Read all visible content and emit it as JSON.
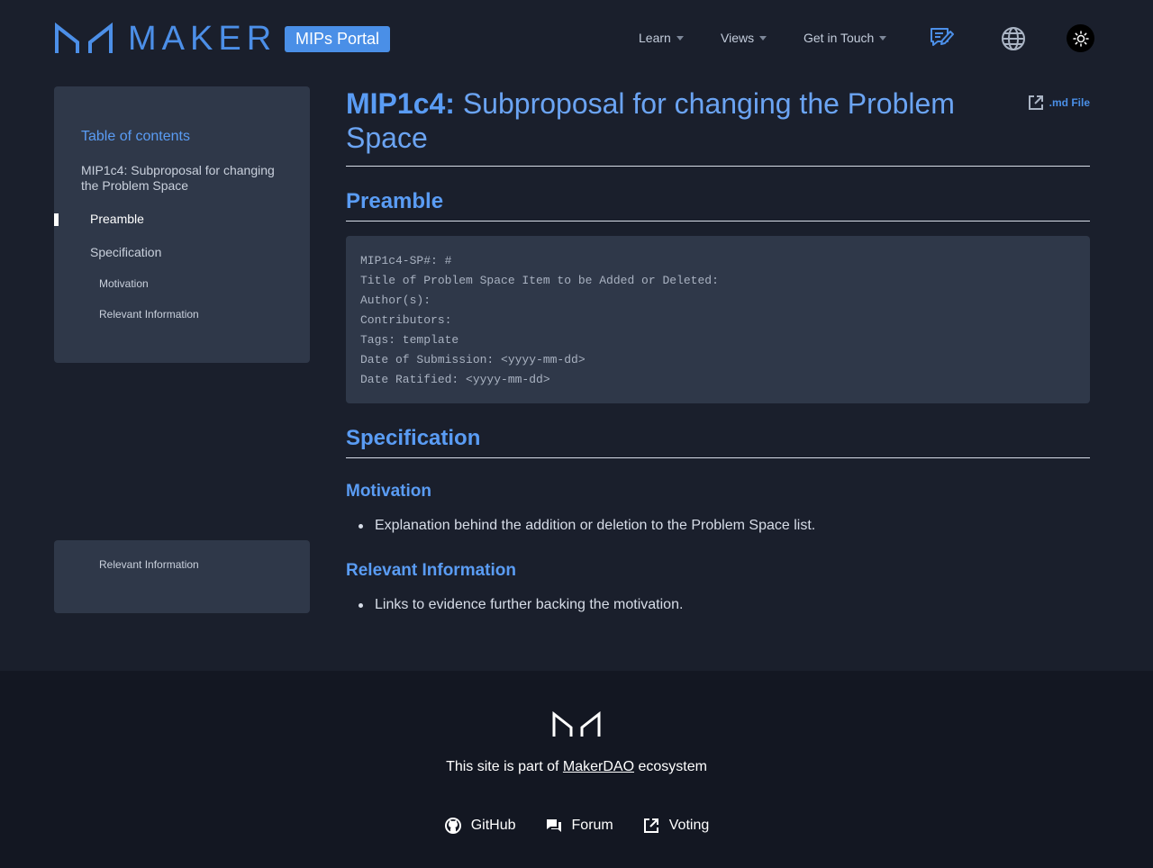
{
  "header": {
    "logo_word": "MAKER",
    "badge": "MIPs Portal",
    "nav": [
      {
        "label": "Learn"
      },
      {
        "label": "Views"
      },
      {
        "label": "Get in Touch"
      }
    ],
    "icons": [
      "forum-edit-icon",
      "globe-icon",
      "sun-icon"
    ]
  },
  "sidebar": {
    "title": "Table of contents",
    "doc_link": "MIP1c4: Subproposal for changing the Problem Space",
    "items": [
      {
        "label": "Preamble",
        "active": true
      },
      {
        "label": "Specification"
      },
      {
        "label": "Motivation"
      },
      {
        "label": "Relevant Information"
      }
    ],
    "sticky_item": "Relevant Information"
  },
  "main": {
    "title_id": "MIP1c4:",
    "title_rest": " Subproposal for changing the Problem Space",
    "md_link": ".md File",
    "preamble_heading": "Preamble",
    "code_lines": [
      "MIP1c4-SP#: #",
      "Title of Problem Space Item to be Added or Deleted:",
      "Author(s):",
      "Contributors:",
      "Tags: template",
      "Date of Submission: <yyyy-mm-dd>",
      "Date Ratified: <yyyy-mm-dd>"
    ],
    "spec_heading": "Specification",
    "motivation_heading": "Motivation",
    "motivation_bullet": "Explanation behind the addition or deletion to the Problem Space list.",
    "relevant_heading": "Relevant Information",
    "relevant_bullet": "Links to evidence further backing the motivation."
  },
  "footer": {
    "text_before": "This site is part of ",
    "link": "MakerDAO",
    "text_after": " ecosystem",
    "links": [
      {
        "label": "GitHub",
        "icon": "github-icon"
      },
      {
        "label": "Forum",
        "icon": "forum-icon"
      },
      {
        "label": "Voting",
        "icon": "external-link-icon"
      }
    ]
  },
  "colors": {
    "background": "#1a1f2c",
    "panel": "#2f3849",
    "accent": "#5a9cf4",
    "footer": "#131722"
  }
}
